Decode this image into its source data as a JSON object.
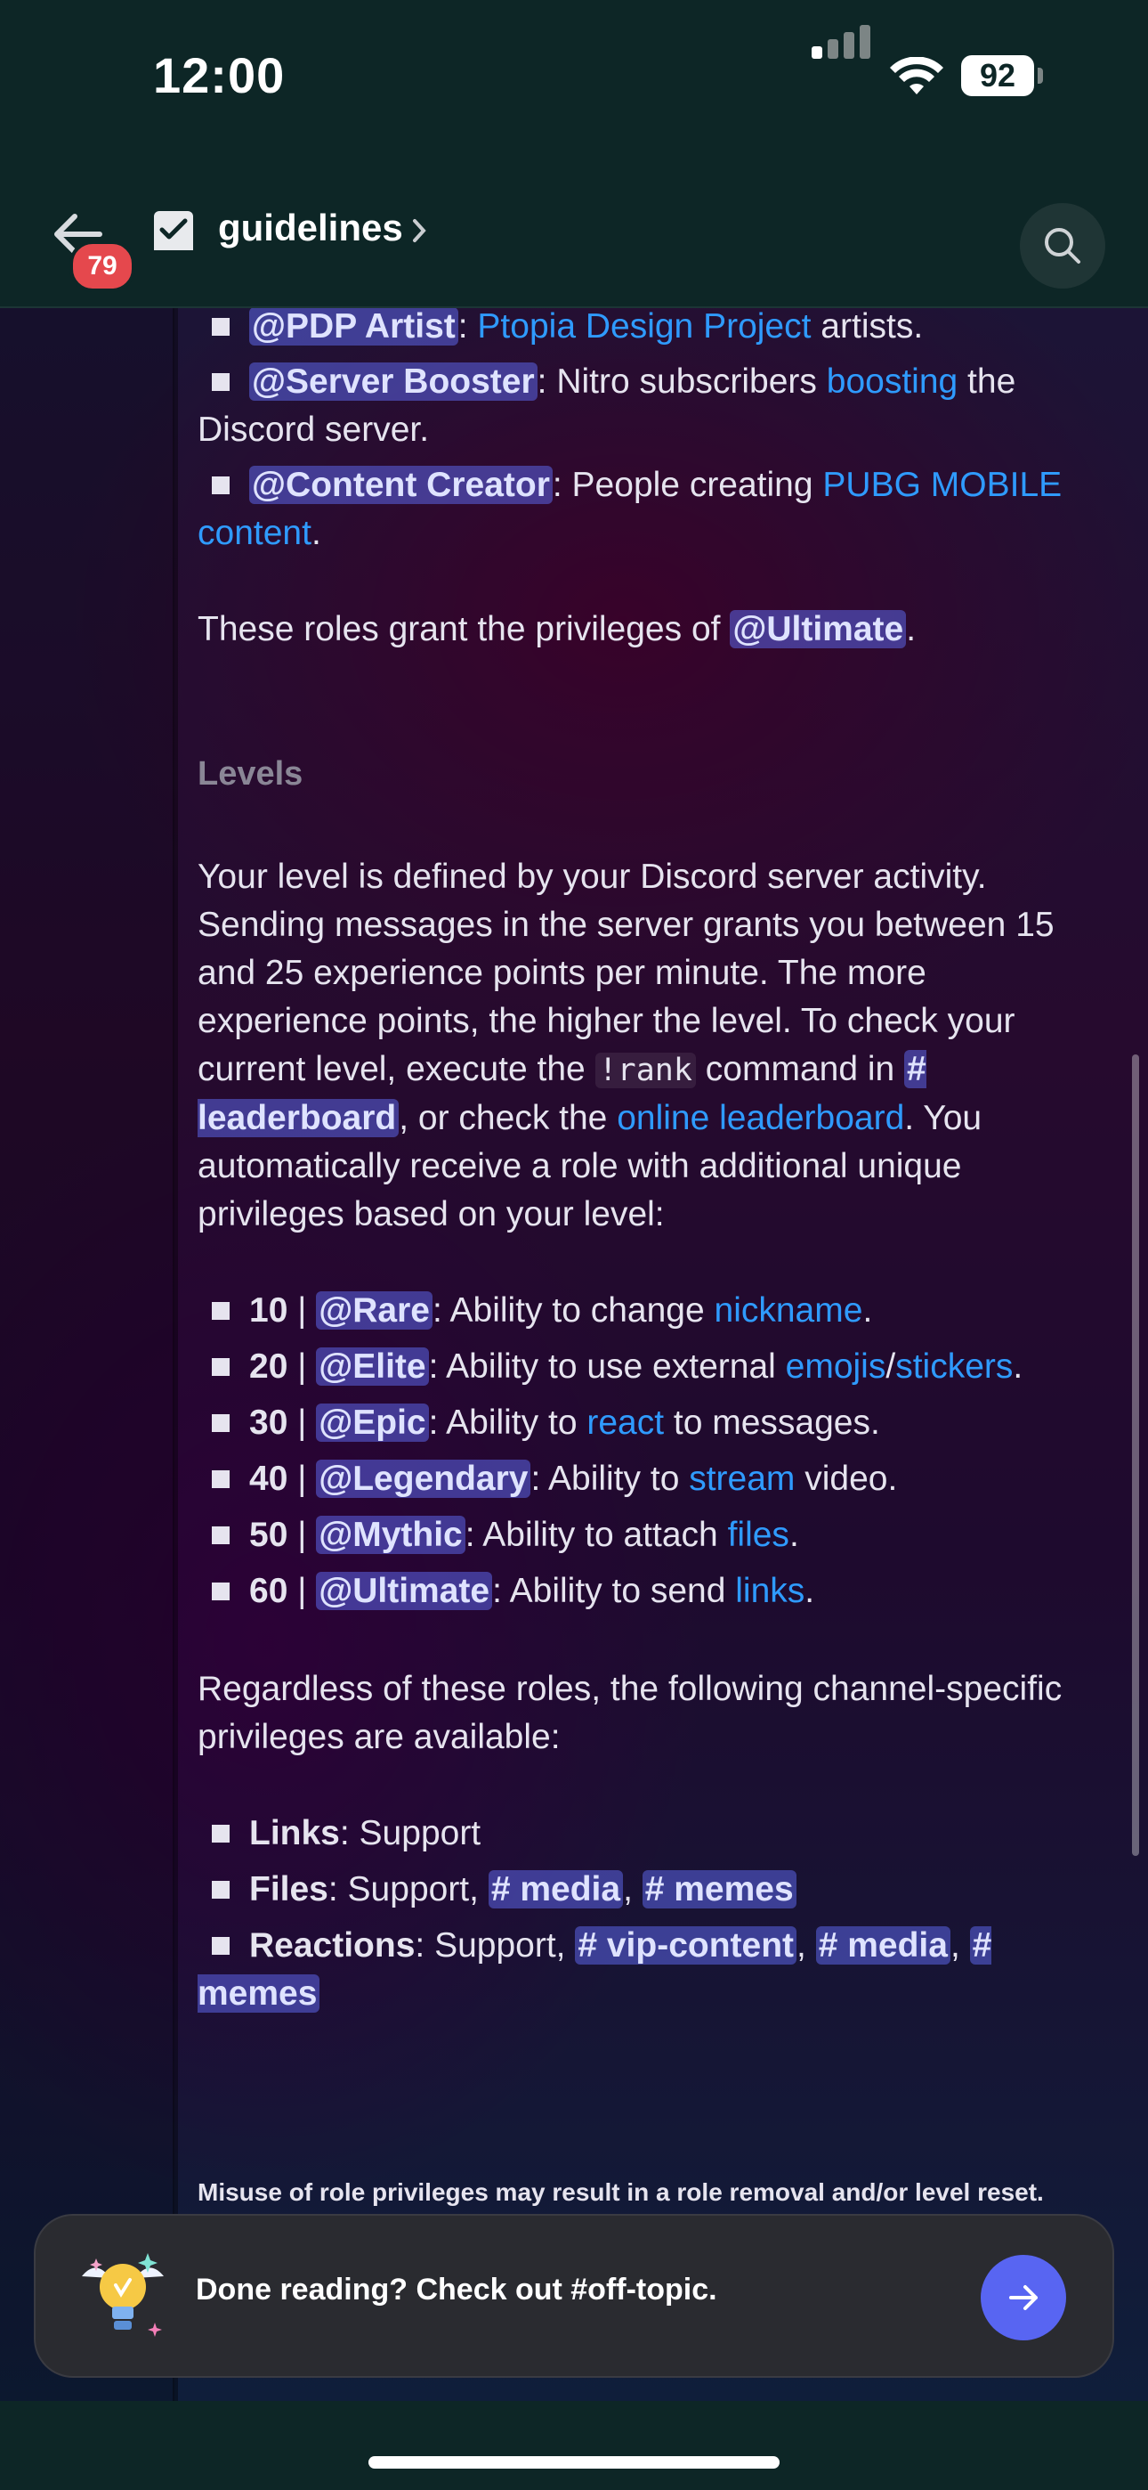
{
  "status": {
    "time": "12:00",
    "battery": "92"
  },
  "header": {
    "badge": "79",
    "title": "guidelines"
  },
  "roles_list": [
    {
      "role": "@PDP Artist",
      "sep": ": ",
      "link": "Ptopia Design Project",
      "after": " artists."
    },
    {
      "role": "@Server Booster",
      "before": ": Nitro subscribers ",
      "link": "boosting",
      "after": " the Discord server."
    },
    {
      "role": "@Content Creator",
      "before": ": People creating ",
      "link": "PUBG MOBILE content",
      "after": "."
    }
  ],
  "roles_grant": {
    "before": "These roles grant the privileges of ",
    "mention": "@Ultimate",
    "after": "."
  },
  "levels": {
    "heading": "Levels",
    "p1": "Your level is defined by your Discord server activity. Sending messages in the server grants you between 15 and 25 experience points per minute. The more experience points, the higher the level. To check your current level, execute the ",
    "code": "!rank",
    "p2": " command in ",
    "channel": "# leaderboard",
    "p3": ", or check the ",
    "link": "online leaderboard",
    "p4": ". You automatically receive a role with additional unique privileges based on your level:"
  },
  "level_items": [
    {
      "num": "10",
      "role": "@Rare",
      "text": ": Ability to change ",
      "link": "nickname",
      "after": "."
    },
    {
      "num": "20",
      "role": "@Elite",
      "text": ": Ability to use external ",
      "link": "emojis",
      "slash": "/",
      "link2": "stickers",
      "after": "."
    },
    {
      "num": "30",
      "role": "@Epic",
      "text": ": Ability to ",
      "link": "react",
      "after": " to messages."
    },
    {
      "num": "40",
      "role": "@Legendary",
      "text": ": Ability to ",
      "link": "stream",
      "after": " video."
    },
    {
      "num": "50",
      "role": "@Mythic",
      "text": ": Ability to attach ",
      "link": "files",
      "after": "."
    },
    {
      "num": "60",
      "role": "@Ultimate",
      "text": ": Ability to send ",
      "link": "links",
      "after": "."
    }
  ],
  "regardless": "Regardless of these roles, the following channel-specific privileges are available:",
  "privileges": {
    "links_label": "Links",
    "links_text": ": Support",
    "files_label": "Files",
    "files_text": ": Support, ",
    "files_ch1": "# media",
    "files_ch2": "# memes",
    "reactions_label": "Reactions",
    "reactions_text": ": Support, ",
    "reactions_ch1": "# vip-content",
    "reactions_ch2": "# media",
    "reactions_ch3": "# memes"
  },
  "misuse_note": "Misuse of role privileges may result in a role removal and/or level reset.",
  "bottom_card": {
    "text": "Done reading? Check out #off-topic."
  },
  "colors": {
    "link": "#2f9bff",
    "mention_bg": "#5b65e6",
    "accent_button": "#5865f2",
    "badge": "#e5484d"
  },
  "icons": [
    "back-arrow-icon",
    "channel-checklist-icon",
    "chevron-right-icon",
    "search-icon",
    "lightbulb-icon",
    "arrow-right-icon"
  ]
}
